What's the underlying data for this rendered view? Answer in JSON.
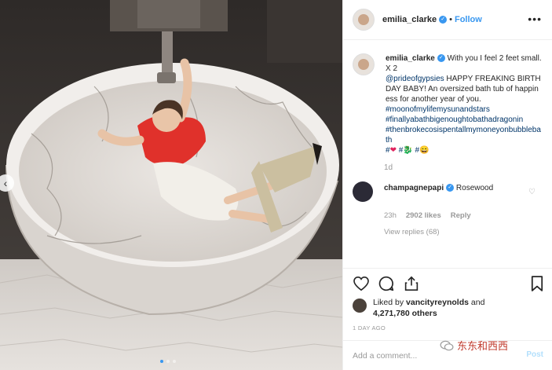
{
  "post": {
    "username": "emilia_clarke",
    "verified_glyph": "✓",
    "separator": "•",
    "follow_label": "Follow",
    "more_label": "•••"
  },
  "caption": {
    "username": "emilia_clarke",
    "line1": "With you I feel 2 feet small.",
    "line2": "X 2",
    "mention": "@prideofgypsies",
    "line3": " HAPPY FREAKING BIRTHDAY BABY! An oversized bath tub of happiness for another year of you.",
    "hashtag1": "#moonofmylifemysunandstars",
    "hashtag2": "#finallyabathbigenoughtobathadragonin",
    "hashtag3": "#thenbrokecosispentallmymoneyonbubblebath",
    "emoji_row": [
      "#",
      "❤",
      " #",
      "🐉",
      " #",
      "😄"
    ],
    "time": "1d"
  },
  "comment": {
    "username": "champagnepapi",
    "text": "Rosewood",
    "time": "23h",
    "likes": "2902 likes",
    "reply_label": "Reply",
    "view_replies": "View replies (68)"
  },
  "likes": {
    "prefix": "Liked by ",
    "user": "vancityreynolds",
    "middle": " and",
    "count": "4,271,780 others"
  },
  "timestamp": "1 DAY AGO",
  "add_comment": {
    "placeholder": "Add a comment...",
    "post_label": "Post"
  },
  "watermark": {
    "text": "东东和西西"
  },
  "carousel": {
    "prev_glyph": "‹"
  },
  "colors": {
    "link": "#3897f0",
    "hashtag": "#003569",
    "muted": "#999999"
  }
}
